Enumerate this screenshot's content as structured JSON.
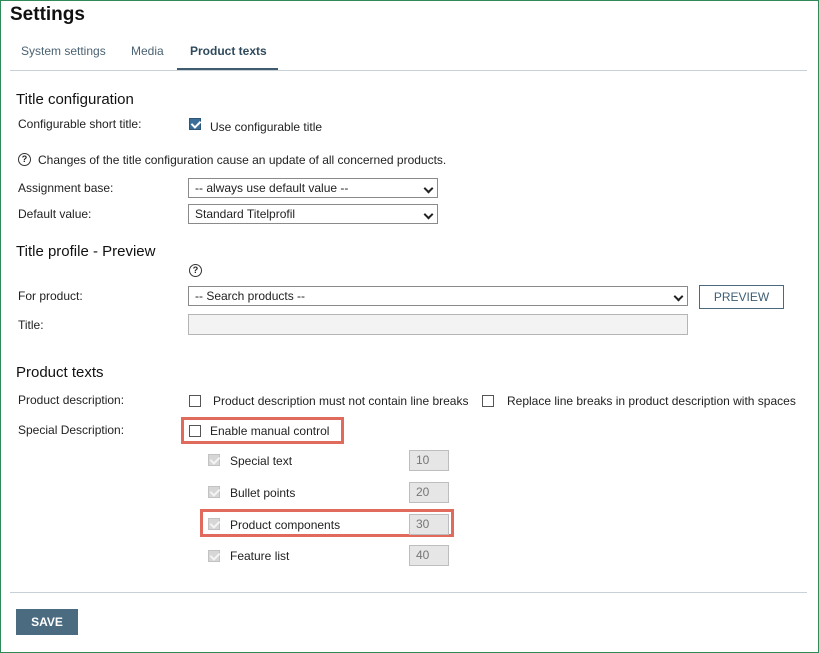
{
  "header": {
    "title": "Settings"
  },
  "tabs": [
    {
      "label": "System settings"
    },
    {
      "label": "Media"
    },
    {
      "label": "Product texts"
    }
  ],
  "title_configuration": {
    "heading": "Title configuration",
    "short_title_label": "Configurable short title:",
    "use_configurable_label": "Use configurable title",
    "use_configurable_checked": true,
    "info_icon_glyph": "?",
    "info_text": "Changes of the title configuration cause an update of all concerned products.",
    "assignment_label": "Assignment base:",
    "assignment_value": "-- always use default value --",
    "default_label": "Default value:",
    "default_value": "Standard Titelprofil"
  },
  "title_profile": {
    "heading": "Title profile - Preview",
    "help_icon_glyph": "?",
    "for_product_label": "For product:",
    "search_value": "-- Search products --",
    "preview_button": "PREVIEW",
    "title_label": "Title:",
    "title_value": ""
  },
  "product_texts": {
    "heading": "Product texts",
    "description_label": "Product description:",
    "no_line_breaks_label": "Product description must not contain line breaks",
    "replace_line_breaks_label": "Replace line breaks in product description with spaces",
    "special_label": "Special Description:",
    "manual_control_label": "Enable manual control",
    "items": [
      {
        "label": "Special text",
        "value": "10"
      },
      {
        "label": "Bullet points",
        "value": "20"
      },
      {
        "label": "Product components",
        "value": "30"
      },
      {
        "label": "Feature list",
        "value": "40"
      }
    ]
  },
  "footer": {
    "save_label": "SAVE"
  },
  "colors": {
    "accent": "#4a6b80",
    "highlight": "#e06a5c",
    "frame": "#2e8b57"
  }
}
